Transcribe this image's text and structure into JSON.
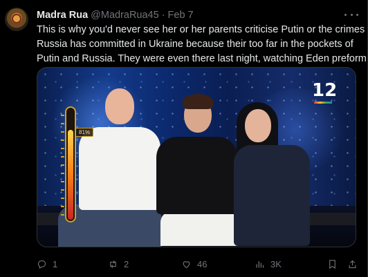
{
  "author": {
    "display_name": "Madra Rua",
    "handle": "@MadraRua45",
    "separator": "·",
    "date": "Feb 7",
    "avatar_icon": "fox-avatar-icon"
  },
  "tweet": {
    "text_lines": [
      "This is why you'd never see her or her parents criticise Putin or the crimes",
      "Russia has committed in Ukraine because their too far in the pockets of",
      "Putin and Russia. They were even there last night, watching Eden preform"
    ]
  },
  "media": {
    "channel_logo": "12",
    "meter_label": "81%",
    "meter_level_percent": 81,
    "colors": {
      "stage_blue": "#143a8a",
      "meter_gold": "#d4a020"
    }
  },
  "actions": {
    "reply_count": "1",
    "retweet_count": "2",
    "like_count": "46",
    "views_count": "3K"
  },
  "colors": {
    "background": "#000000",
    "text": "#e7e9ea",
    "muted": "#71767b"
  }
}
